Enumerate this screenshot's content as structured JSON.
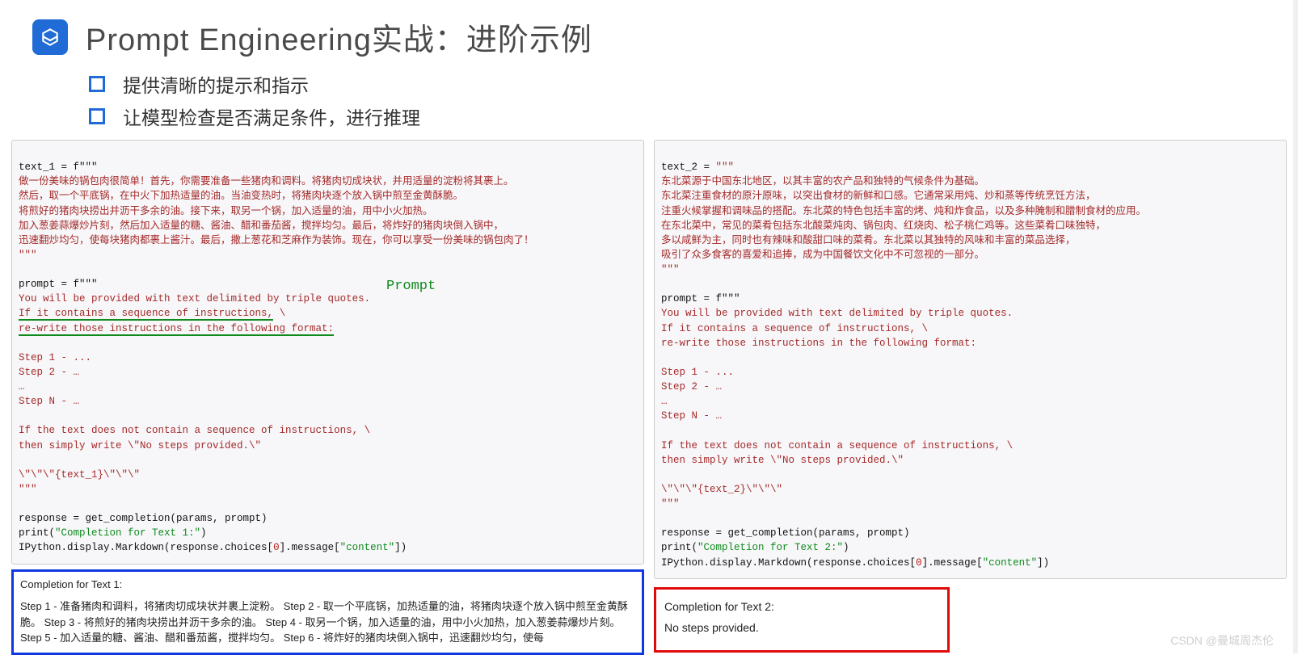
{
  "header": {
    "title": "Prompt Engineering实战：进阶示例"
  },
  "bullets": [
    "提供清晰的提示和指示",
    "让模型检查是否满足条件，进行推理"
  ],
  "prompt_label": "Prompt",
  "left": {
    "line_var": "text_1 = f\"\"\"",
    "body1": "做一份美味的锅包肉很简单！首先，你需要准备一些猪肉和调料。将猪肉切成块状，并用适量的淀粉将其裹上。",
    "body2": "然后，取一个平底锅，在中火下加热适量的油。当油变热时，将猪肉块逐个放入锅中煎至金黄酥脆。",
    "body3": "将煎好的猪肉块捞出并沥干多余的油。接下来，取另一个锅，加入适量的油，用中小火加热。",
    "body4": "加入葱姜蒜爆炒片刻，然后加入适量的糖、酱油、醋和番茄酱，搅拌均匀。最后，将炸好的猪肉块倒入锅中，",
    "body5": "迅速翻炒均匀，使每块猪肉都裹上酱汁。最后，撒上葱花和芝麻作为装饰。现在，你可以享受一份美味的锅包肉了！",
    "body_end": "\"\"\"",
    "p_var": "prompt = f\"\"\"",
    "p1": "You will be provided with text delimited by triple quotes.",
    "p2a": "If it contains a sequence of instructions,",
    "p2b": " \\",
    "p3": "re-write those instructions in the following format:",
    "s1": "Step 1 - ...",
    "s2": "Step 2 - …",
    "sd": "…",
    "sn": "Step N - …",
    "p4": "If the text does not contain a sequence of instructions, \\",
    "p5": "then simply write \\\"No steps provided.\\\"",
    "p6": "\\\"\\\"\\\"{text_1}\\\"\\\"\\\"",
    "p_end": "\"\"\"",
    "call": "response = get_completion(params, prompt)",
    "print_a": "print(",
    "print_b": "\"Completion for Text 1:\"",
    "print_c": ")",
    "disp_a": "IPython.display.Markdown(response.choices[",
    "disp_b": "0",
    "disp_c": "].message[",
    "disp_d": "\"content\"",
    "disp_e": "])",
    "out_title": "Completion for Text 1:",
    "out_body": "Step 1 - 准备猪肉和调料，将猪肉切成块状并裹上淀粉。 Step 2 - 取一个平底锅，加热适量的油，将猪肉块逐个放入锅中煎至金黄酥脆。 Step 3 - 将煎好的猪肉块捞出并沥干多余的油。 Step 4 - 取另一个锅，加入适量的油，用中小火加热，加入葱姜蒜爆炒片刻。 Step 5 - 加入适量的糖、酱油、醋和番茄酱，搅拌均匀。 Step 6 - 将炸好的猪肉块倒入锅中，迅速翻炒均匀，使每"
  },
  "right": {
    "line_var_a": "text_2 = ",
    "line_var_b": "\"\"\"",
    "body1": "东北菜源于中国东北地区，以其丰富的农产品和独特的气候条件为基础。",
    "body2": "东北菜注重食材的原汁原味，以突出食材的新鲜和口感。它通常采用炖、炒和蒸等传统烹饪方法，",
    "body3": "注重火候掌握和调味品的搭配。东北菜的特色包括丰富的烤、炖和炸食品，以及多种腌制和腊制食材的应用。",
    "body4": "在东北菜中，常见的菜肴包括东北酸菜炖肉、锅包肉、红烧肉、松子桃仁鸡等。这些菜肴口味独特，",
    "body5": "多以咸鲜为主，同时也有辣味和酸甜口味的菜肴。东北菜以其独特的风味和丰富的菜品选择，",
    "body6": "吸引了众多食客的喜爱和追捧，成为中国餐饮文化中不可忽视的一部分。",
    "body_end": "\"\"\"",
    "p_var": "prompt = f\"\"\"",
    "p1": "You will be provided with text delimited by triple quotes.",
    "p2": "If it contains a sequence of instructions, \\",
    "p3": "re-write those instructions in the following format:",
    "s1": "Step 1 - ...",
    "s2": "Step 2 - …",
    "sd": "…",
    "sn": "Step N - …",
    "p4": "If the text does not contain a sequence of instructions, \\",
    "p5": "then simply write \\\"No steps provided.\\\"",
    "p6": "\\\"\\\"\\\"{text_2}\\\"\\\"\\\"",
    "p_end": "\"\"\"",
    "call": "response = get_completion(params, prompt)",
    "print_a": "print(",
    "print_b": "\"Completion for Text 2:\"",
    "print_c": ")",
    "disp_a": "IPython.display.Markdown(response.choices[",
    "disp_b": "0",
    "disp_c": "].message[",
    "disp_d": "\"content\"",
    "disp_e": "])",
    "out_title": "Completion for Text 2:",
    "out_body": "No steps provided."
  },
  "watermark": "CSDN @曼城周杰伦"
}
